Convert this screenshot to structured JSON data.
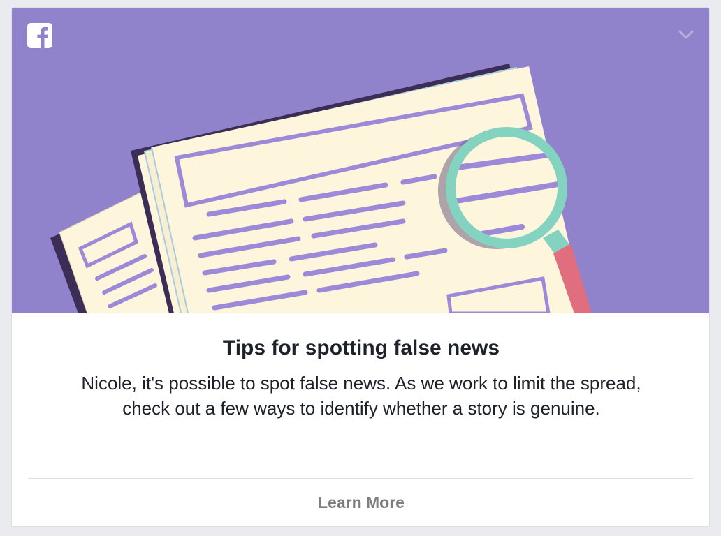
{
  "card": {
    "title": "Tips for spotting false news",
    "body": "Nicole, it's possible to spot false news. As we work to limit the spread, check out a few ways to identify whether a story is genuine.",
    "cta_label": "Learn More"
  },
  "header": {
    "logo_icon": "facebook-logo-icon",
    "menu_icon": "chevron-down-icon"
  },
  "illustration": {
    "subject": "newspapers-with-magnifying-glass",
    "colors": {
      "background": "#9083cc",
      "paper": "#fdf5dc",
      "lines": "#9c8ad8",
      "shadow": "#3b2d55",
      "lens_ring": "#84d3c1",
      "handle": "#e06e7e"
    }
  }
}
